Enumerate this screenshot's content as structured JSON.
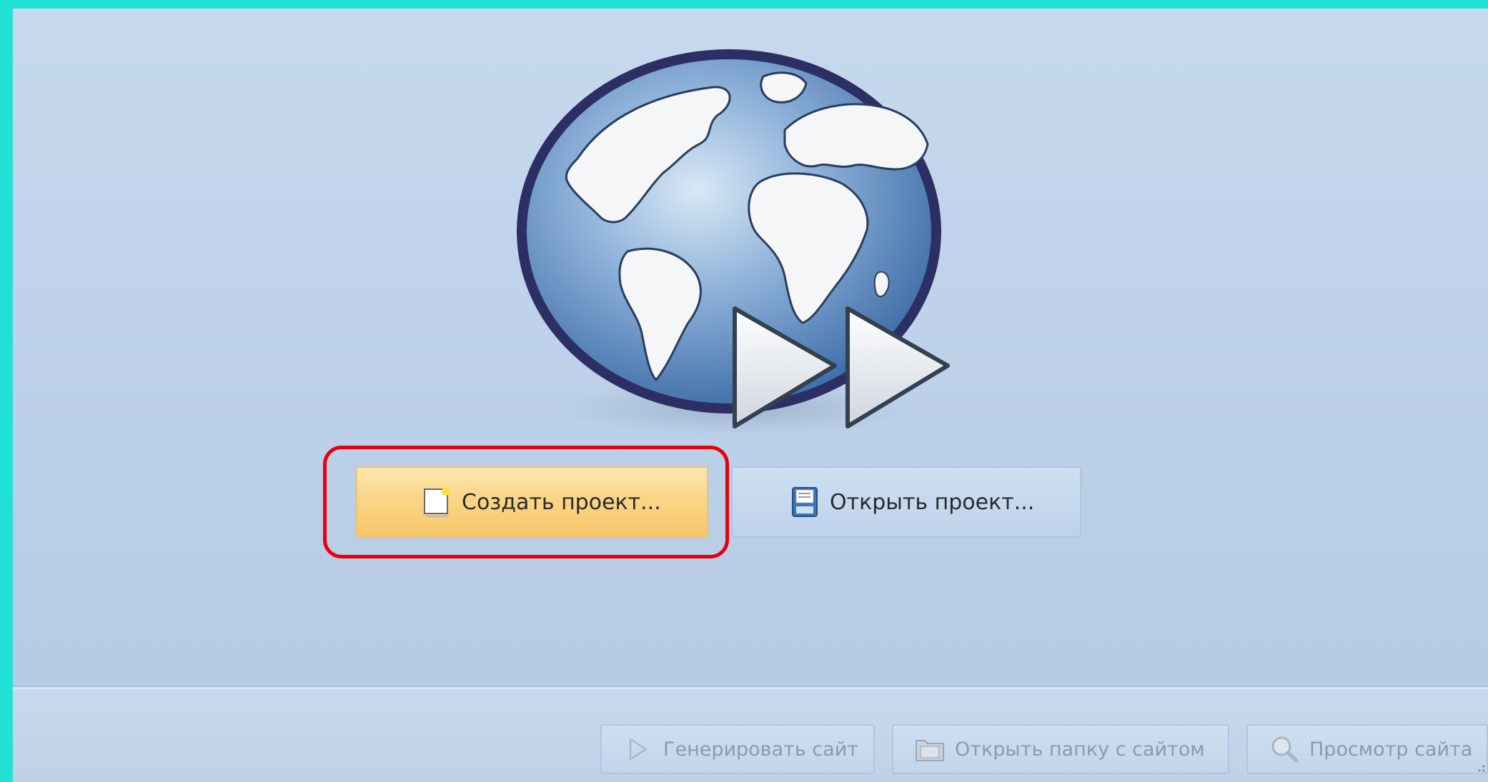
{
  "colors": {
    "frame": "#22e2d6",
    "window_bg": "#c3d6ec",
    "create_button": "#fbd587",
    "highlight_outline": "#e8000b"
  },
  "main": {
    "logo_icon": "globe-forward-icon",
    "create_project": {
      "label": "Создать проект...",
      "icon": "new-document-icon",
      "highlighted": true
    },
    "open_project": {
      "label": "Открыть проект...",
      "icon": "open-project-icon"
    }
  },
  "toolbar": {
    "generate": {
      "label": "Генерировать сайт",
      "icon": "play-icon",
      "enabled": false
    },
    "open_folder": {
      "label": "Открыть папку с сайтом",
      "icon": "folder-icon",
      "enabled": false
    },
    "preview": {
      "label": "Просмотр сайта",
      "icon": "magnifier-icon",
      "enabled": false
    }
  }
}
